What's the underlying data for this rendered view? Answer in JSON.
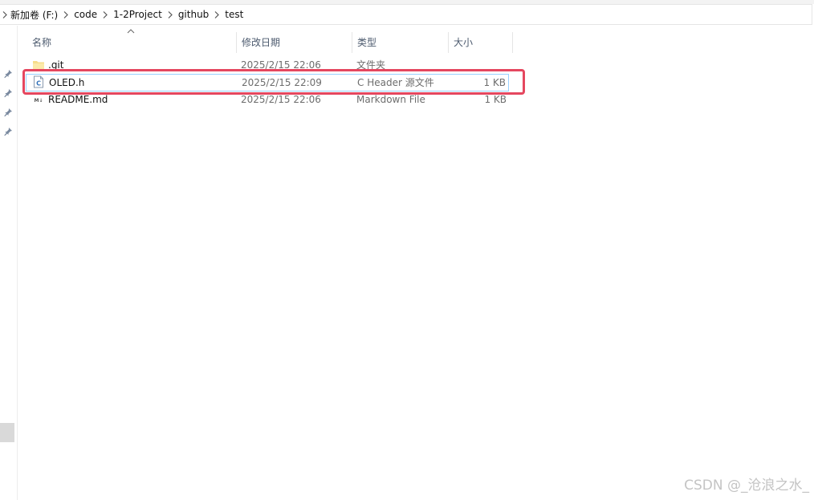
{
  "breadcrumb": {
    "items": [
      "新加卷 (F:)",
      "code",
      "1-2Project",
      "github",
      "test"
    ]
  },
  "columns": {
    "name": "名称",
    "date": "修改日期",
    "type": "类型",
    "size": "大小"
  },
  "files": [
    {
      "name": ".git",
      "date": "2025/2/15 22:06",
      "type": "文件夹",
      "size": "",
      "icon": "folder-icon"
    },
    {
      "name": "OLED.h",
      "date": "2025/2/15 22:09",
      "type": "C Header 源文件",
      "size": "1 KB",
      "icon": "c-header-file-icon"
    },
    {
      "name": "README.md",
      "date": "2025/2/15 22:06",
      "type": "Markdown File",
      "size": "1 KB",
      "icon": "markdown-file-icon"
    }
  ],
  "colors": {
    "highlight_border": "#e5475f",
    "selection_border": "#99d1ff",
    "header_text": "#4c5a6e"
  },
  "watermark": "CSDN @_沧浪之水_"
}
